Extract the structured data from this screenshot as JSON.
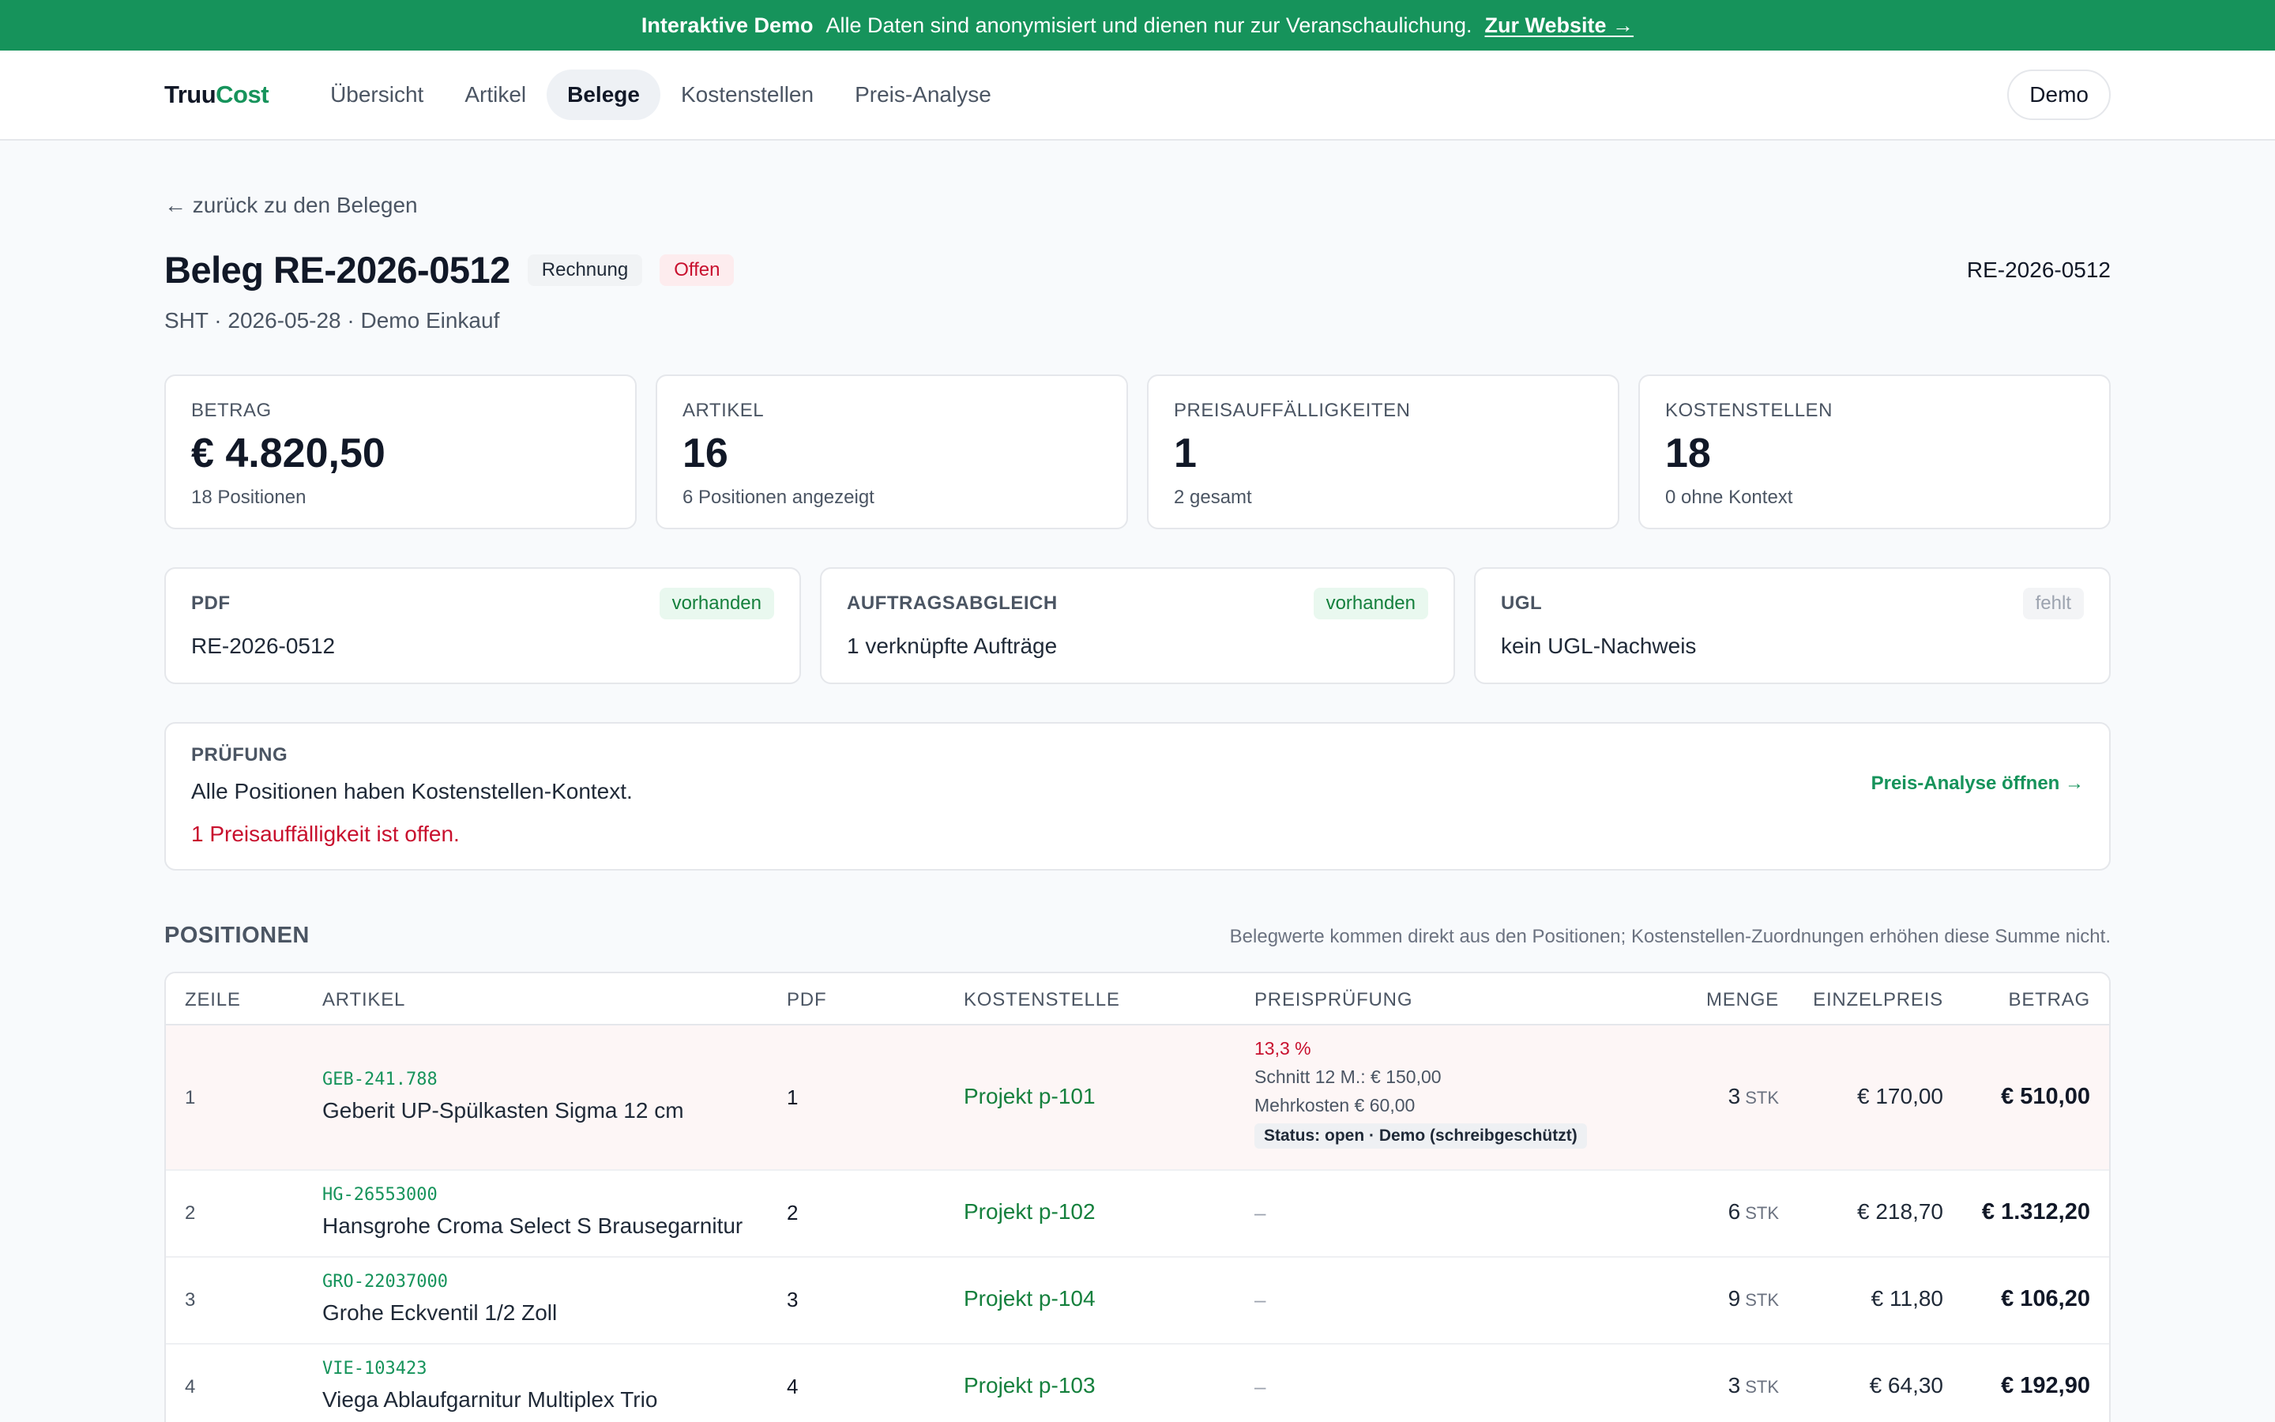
{
  "banner": {
    "strong": "Interaktive Demo",
    "text": "Alle Daten sind anonymisiert und dienen nur zur Veranschaulichung.",
    "link": "Zur Website →"
  },
  "nav": {
    "brand_a": "Truu",
    "brand_b": "Cost",
    "items": [
      {
        "label": "Übersicht"
      },
      {
        "label": "Artikel"
      },
      {
        "label": "Belege"
      },
      {
        "label": "Kostenstellen"
      },
      {
        "label": "Preis-Analyse"
      }
    ],
    "active_index": 2,
    "demo": "Demo"
  },
  "header": {
    "back": "← zurück zu den Belegen",
    "title": "Beleg RE-2026-0512",
    "type_badge": "Rechnung",
    "status_badge": "Offen",
    "subtitle": "SHT · 2026-05-28 · Demo Einkauf",
    "doc_number": "RE-2026-0512"
  },
  "stats": [
    {
      "label": "BETRAG",
      "value": "€ 4.820,50",
      "sub": "18 Positionen"
    },
    {
      "label": "ARTIKEL",
      "value": "16",
      "sub": "6 Positionen angezeigt"
    },
    {
      "label": "PREISAUFFÄLLIGKEITEN",
      "value": "1",
      "sub": "2 gesamt"
    },
    {
      "label": "KOSTENSTELLEN",
      "value": "18",
      "sub": "0 ohne Kontext"
    }
  ],
  "docs": [
    {
      "label": "PDF",
      "badge": "vorhanden",
      "value": "RE-2026-0512"
    },
    {
      "label": "AUFTRAGSABGLEICH",
      "badge": "vorhanden",
      "value": "1 verknüpfte Aufträge"
    },
    {
      "label": "UGL",
      "badge": "fehlt",
      "value": "kein UGL-Nachweis"
    }
  ],
  "check": {
    "label": "PRÜFUNG",
    "ok": "Alle Positionen haben Kostenstellen-Kontext.",
    "warn": "1 Preisauffälligkeit ist offen.",
    "link": "Preis-Analyse öffnen →"
  },
  "positions": {
    "title": "POSITIONEN",
    "note": "Belegwerte kommen direkt aus den Positionen; Kostenstellen-Zuordnungen erhöhen diese Summe nicht.",
    "columns": [
      "ZEILE",
      "ARTIKEL",
      "PDF",
      "KOSTENSTELLE",
      "PREISPRÜFUNG",
      "MENGE",
      "EINZELPREIS",
      "BETRAG"
    ],
    "rows": [
      {
        "line": "1",
        "sku": "GEB-241.788",
        "name": "Geberit UP-Spülkasten Sigma 12 cm",
        "pdf": "1",
        "cost_center": "Projekt p-101",
        "price_check": {
          "pct": "13,3 %",
          "avg": "Schnitt 12 M.: € 150,00",
          "extra": "Mehrkosten € 60,00",
          "status": "Status: open · Demo (schreibgeschützt)"
        },
        "qty": "3",
        "unit": "STK",
        "unit_price": "€ 170,00",
        "amount": "€ 510,00"
      },
      {
        "line": "2",
        "sku": "HG-26553000",
        "name": "Hansgrohe Croma Select S Brausegarnitur",
        "pdf": "2",
        "cost_center": "Projekt p-102",
        "price_check_none": "–",
        "qty": "6",
        "unit": "STK",
        "unit_price": "€ 218,70",
        "amount": "€ 1.312,20"
      },
      {
        "line": "3",
        "sku": "GRO-22037000",
        "name": "Grohe Eckventil 1/2 Zoll",
        "pdf": "3",
        "cost_center": "Projekt p-104",
        "price_check_none": "–",
        "qty": "9",
        "unit": "STK",
        "unit_price": "€ 11,80",
        "amount": "€ 106,20"
      },
      {
        "line": "4",
        "sku": "VIE-103423",
        "name": "Viega Ablaufgarnitur Multiplex Trio",
        "pdf": "4",
        "cost_center": "Projekt p-103",
        "price_check_none": "–",
        "qty": "3",
        "unit": "STK",
        "unit_price": "€ 64,30",
        "amount": "€ 192,90"
      }
    ]
  },
  "colors": {
    "brand": "#16935b",
    "danger": "#c8102e"
  }
}
